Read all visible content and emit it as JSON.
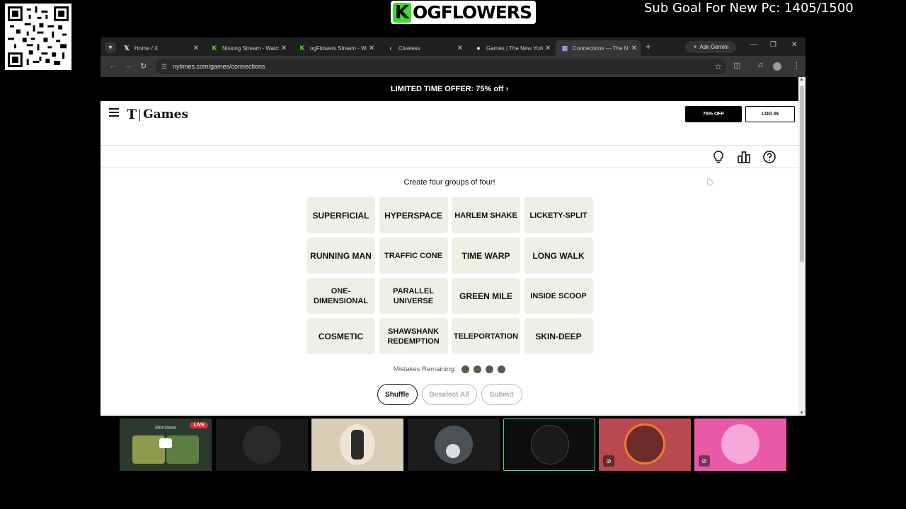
{
  "overlay": {
    "logo_letter": "K",
    "logo_text": "OGFLOWERS",
    "sub_goal": "Sub Goal For New Pc: 1405/1500"
  },
  "browser": {
    "tabs": [
      {
        "title": "Home / X",
        "icon": "x-logo-icon",
        "color": "#ffffff"
      },
      {
        "title": "Nissing Stream - Watch",
        "icon": "kick-logo-icon",
        "color": "#53fc18"
      },
      {
        "title": "ogFlowers Stream - Wa",
        "icon": "kick-logo-icon",
        "color": "#53fc18"
      },
      {
        "title": "Clueless",
        "icon": "chevron-left-icon",
        "color": "#f7c948"
      },
      {
        "title": "Games | The New York",
        "icon": "nyt-logo-icon",
        "color": "#ffffff"
      },
      {
        "title": "Connections — The N",
        "icon": "connections-icon",
        "color": "#b18ee8"
      }
    ],
    "ask_gemini": "Ask Gemini",
    "url": "nytimes.com/games/connections"
  },
  "page": {
    "promo": "LIMITED TIME OFFER: 75% off ›",
    "brand_t": "T",
    "brand_games": "Games",
    "offer_button": "75% OFF",
    "login_button": "LOG IN",
    "instructions": "Create four groups of four!",
    "words": [
      "SUPERFICIAL",
      "HYPERSPACE",
      "HARLEM SHAKE",
      "LICKETY-SPLIT",
      "RUNNING MAN",
      "TRAFFIC CONE",
      "TIME WARP",
      "LONG WALK",
      "ONE-DIMENSIONAL",
      "PARALLEL UNIVERSE",
      "GREEN MILE",
      "INSIDE SCOOP",
      "COSMETIC",
      "SHAWSHANK REDEMPTION",
      "TELEPORTATION",
      "SKIN-DEEP"
    ],
    "mistakes_label": "Mistakes Remaining:",
    "mistakes_remaining": 4,
    "shuffle": "Shuffle",
    "deselect_all": "Deselect All",
    "submit": "Submit"
  },
  "webcams": {
    "live_badge": "LIVE",
    "first_cam_label": "Monstees"
  },
  "colors": {
    "card_bg": "#efefe6",
    "mistake_dot": "#5a594e",
    "kick_green": "#53fc18"
  }
}
